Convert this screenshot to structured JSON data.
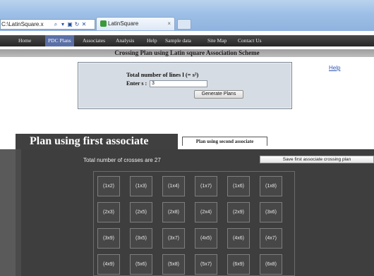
{
  "browser": {
    "address": "C:\\LatinSquare.x",
    "tab_title": "LatinSquare",
    "tab_close": "×"
  },
  "nav": {
    "items": [
      "Home",
      "PDC Plans",
      "Associates",
      "Analysis",
      "Help",
      "Sample data",
      "Site Map",
      "Contact Us"
    ],
    "active_index": 1
  },
  "header": {
    "title": "Crossing Plan using Latin square Association Scheme",
    "help_link": "Help"
  },
  "form": {
    "total_lines_label": "Total number of lines l (= s²)",
    "enter_s_label": "Enter s :",
    "s_value": "3",
    "generate_button": "Generate Plans"
  },
  "plans": {
    "active_tab": "Plan using first associate",
    "second_tab": "Plan using second associate",
    "crosses_text": "Total number of crosses are 27",
    "save_button": "Save first associate crossing plan",
    "crosses": [
      [
        "(1x2)",
        "(1x3)",
        "(1x4)",
        "(1x7)",
        "(1x6)",
        "(1x8)"
      ],
      [
        "(2x3)",
        "(2x5)",
        "(2x8)",
        "(2x4)",
        "(2x9)",
        "(3x6)"
      ],
      [
        "(3x9)",
        "(3x5)",
        "(3x7)",
        "(4x5)",
        "(4x6)",
        "(4x7)"
      ],
      [
        "(4x9)",
        "(5x6)",
        "(5x8)",
        "(5x7)",
        "(6x9)",
        "(6x8)"
      ]
    ]
  }
}
